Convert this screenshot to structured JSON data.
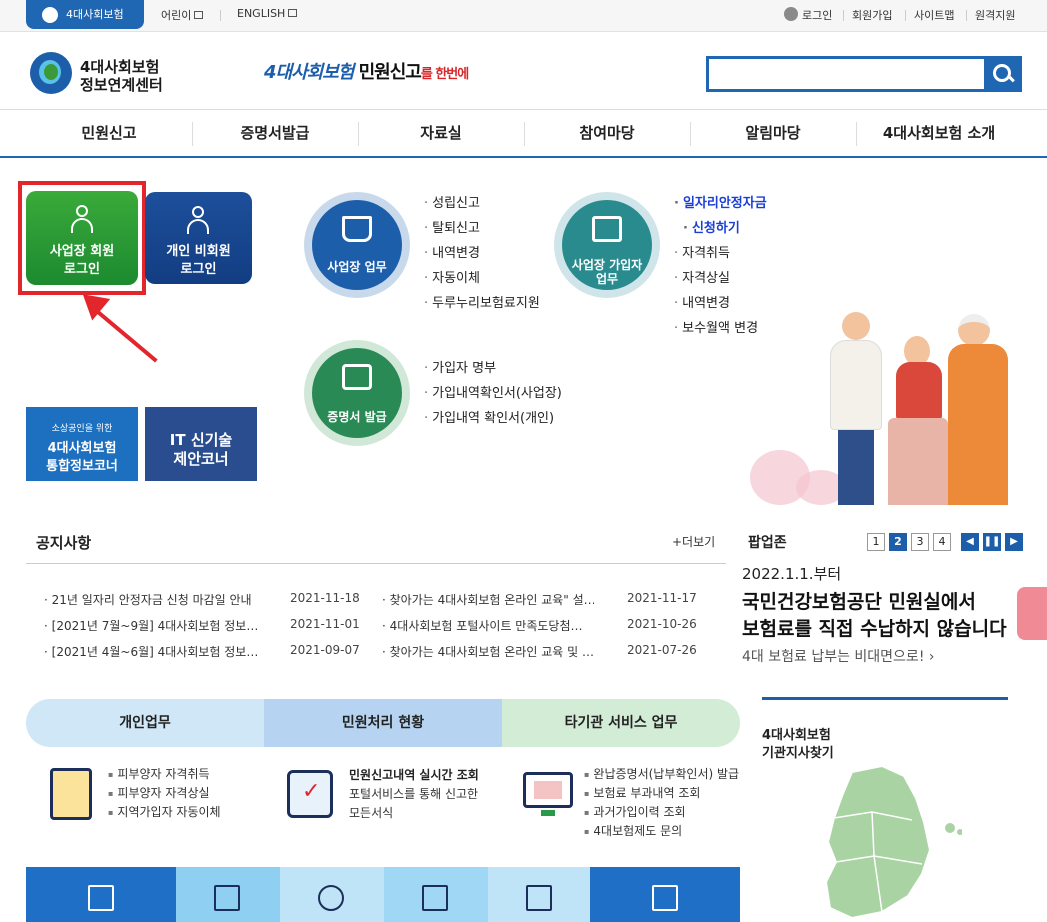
{
  "top_bar": {
    "main_tab": "4대사회보험",
    "kids": "어린이",
    "english": "ENGLISH",
    "login": "로그인",
    "join": "회원가입",
    "sitemap": "사이트맵",
    "remote": "원격지원"
  },
  "header": {
    "logo_line1": "4대사회보험",
    "logo_line2": "정보연계센터",
    "slogan_a": "4대사회보험",
    "slogan_b": "민원신고",
    "slogan_c": "를 한번에",
    "search_value": ""
  },
  "gnb": [
    "민원신고",
    "증명서발급",
    "자료실",
    "참여마당",
    "알림마당",
    "4대사회보험 소개"
  ],
  "login": {
    "biz_line1": "사업장 회원",
    "biz_line2": "로그인",
    "per_line1": "개인 비회원",
    "per_line2": "로그인"
  },
  "banners": {
    "small_line1": "소상공인을 위한",
    "small_line2": "4대사회보험",
    "small_line3": "통합정보코너",
    "it_line1": "IT 신기술",
    "it_line2": "제안코너"
  },
  "workplace": {
    "label": "사업장 업무",
    "items": [
      "성립신고",
      "탈퇴신고",
      "내역변경",
      "자동이체",
      "두루누리보험료지원"
    ]
  },
  "member": {
    "label_line1": "사업장 가입자",
    "label_line2": "업무",
    "highlight_line1": "일자리안정자금",
    "highlight_line2": "신청하기",
    "items": [
      "자격취득",
      "자격상실",
      "내역변경",
      "보수월액 변경"
    ]
  },
  "certificate": {
    "label": "증명서 발급",
    "items": [
      "가입자 명부",
      "가입내역확인서(사업장)",
      "가입내역 확인서(개인)"
    ]
  },
  "notice": {
    "title": "공지사항",
    "more": "+더보기",
    "rows": [
      {
        "left_title": "21년 일자리 안정자금 신청 마감일 안내",
        "left_date": "2021-11-18",
        "right_title": "찾아가는 4대사회보험 온라인 교육\" 설…",
        "right_date": "2021-11-17"
      },
      {
        "left_title": "[2021년 7월~9월] 4대사회보험 정보…",
        "left_date": "2021-11-01",
        "right_title": "4대사회보험 포털사이트 만족도당첨…",
        "right_date": "2021-10-26"
      },
      {
        "left_title": "[2021년 4월~6월] 4대사회보험 정보…",
        "left_date": "2021-09-07",
        "right_title": "찾아가는 4대사회보험 온라인 교육 및 …",
        "right_date": "2021-07-26"
      }
    ]
  },
  "popup": {
    "title": "팝업존",
    "pages": [
      "1",
      "2",
      "3",
      "4"
    ],
    "active_page": "2",
    "date": "2022.1.1.부터",
    "line1": "국민건강보험공단 민원실에서",
    "line2": "보험료를 직접 수납하지 않습니다",
    "sub": "4대 보험료 납부는 비대면으로!"
  },
  "services": {
    "tabs": [
      "개인업무",
      "민원처리 현황",
      "타기관 서비스 업무"
    ],
    "personal": [
      "피부양자 자격취득",
      "피부양자 자격상실",
      "지역가입자 자동이체"
    ],
    "status_title": "민원신고내역 실시간 조회",
    "status_desc_line1": "포털서비스를 통해 신고한",
    "status_desc_line2": "모든서식",
    "other": [
      "완납증명서(납부확인서) 발급",
      "보험료 부과내역 조회",
      "과거가입이력 조회",
      "4대보험제도 문의"
    ]
  },
  "branch": {
    "title_line1": "4대사회보험",
    "title_line2": "기관지사찾기"
  },
  "colors": {
    "primary_blue": "#1f67b3",
    "login_green": "#1c8a2f",
    "highlight_red": "#e3262c"
  }
}
